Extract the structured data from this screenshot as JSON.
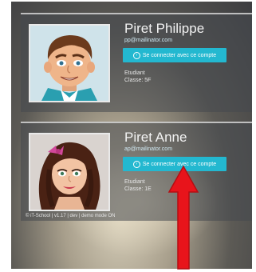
{
  "profiles": [
    {
      "name": "Piret Philippe",
      "email": "pp@mailinator.com",
      "button_label": "Se connecter avec ce compte",
      "role": "Etudiant",
      "class_label": "Classe: 5F"
    },
    {
      "name": "Piret Anne",
      "email": "ap@mailinator.com",
      "button_label": "Se connecter avec ce compte",
      "role": "Etudiant",
      "class_label": "Classe: 1E"
    }
  ],
  "footer": {
    "text": "© iT-School | v1.17 | dev | demo mode ON"
  },
  "colors": {
    "accent": "#23b8d0",
    "annotation_arrow": "#e8141b"
  },
  "icons": {
    "button_icon": "circle-arrow-icon"
  }
}
